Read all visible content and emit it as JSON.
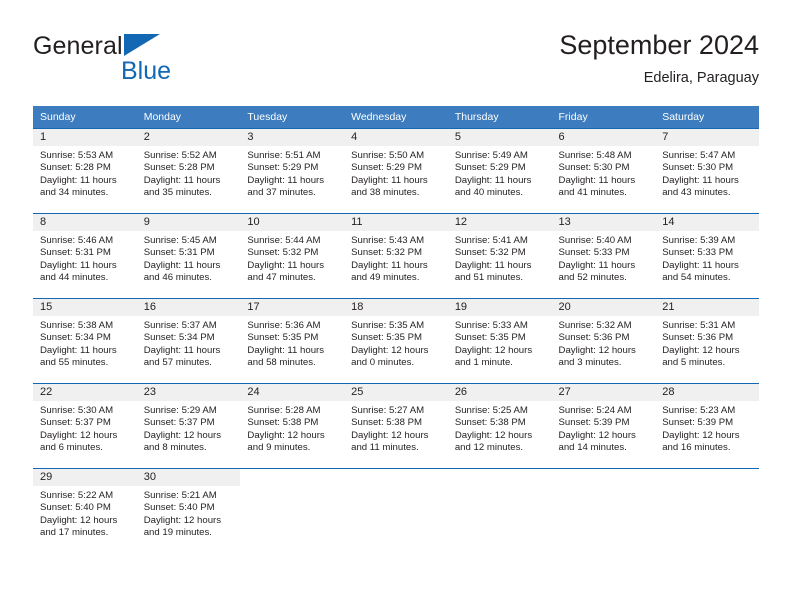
{
  "logo": {
    "word1": "General",
    "word2": "Blue",
    "triangle_color": "#1268b3"
  },
  "header": {
    "title": "September 2024",
    "subtitle": "Edelira, Paraguay"
  },
  "theme": {
    "header_bg": "#3c7cbf",
    "row_separator": "#1268b3",
    "daynum_bg": "#f0f0f0",
    "text": "#231f20"
  },
  "weekdays": [
    "Sunday",
    "Monday",
    "Tuesday",
    "Wednesday",
    "Thursday",
    "Friday",
    "Saturday"
  ],
  "labels": {
    "sunrise_prefix": "Sunrise:",
    "sunset_prefix": "Sunset:",
    "daylight_prefix": "Daylight:"
  },
  "weeks": [
    [
      {
        "day": "1",
        "sunrise": "Sunrise: 5:53 AM",
        "sunset": "Sunset: 5:28 PM",
        "daylight1": "Daylight: 11 hours",
        "daylight2": "and 34 minutes."
      },
      {
        "day": "2",
        "sunrise": "Sunrise: 5:52 AM",
        "sunset": "Sunset: 5:28 PM",
        "daylight1": "Daylight: 11 hours",
        "daylight2": "and 35 minutes."
      },
      {
        "day": "3",
        "sunrise": "Sunrise: 5:51 AM",
        "sunset": "Sunset: 5:29 PM",
        "daylight1": "Daylight: 11 hours",
        "daylight2": "and 37 minutes."
      },
      {
        "day": "4",
        "sunrise": "Sunrise: 5:50 AM",
        "sunset": "Sunset: 5:29 PM",
        "daylight1": "Daylight: 11 hours",
        "daylight2": "and 38 minutes."
      },
      {
        "day": "5",
        "sunrise": "Sunrise: 5:49 AM",
        "sunset": "Sunset: 5:29 PM",
        "daylight1": "Daylight: 11 hours",
        "daylight2": "and 40 minutes."
      },
      {
        "day": "6",
        "sunrise": "Sunrise: 5:48 AM",
        "sunset": "Sunset: 5:30 PM",
        "daylight1": "Daylight: 11 hours",
        "daylight2": "and 41 minutes."
      },
      {
        "day": "7",
        "sunrise": "Sunrise: 5:47 AM",
        "sunset": "Sunset: 5:30 PM",
        "daylight1": "Daylight: 11 hours",
        "daylight2": "and 43 minutes."
      }
    ],
    [
      {
        "day": "8",
        "sunrise": "Sunrise: 5:46 AM",
        "sunset": "Sunset: 5:31 PM",
        "daylight1": "Daylight: 11 hours",
        "daylight2": "and 44 minutes."
      },
      {
        "day": "9",
        "sunrise": "Sunrise: 5:45 AM",
        "sunset": "Sunset: 5:31 PM",
        "daylight1": "Daylight: 11 hours",
        "daylight2": "and 46 minutes."
      },
      {
        "day": "10",
        "sunrise": "Sunrise: 5:44 AM",
        "sunset": "Sunset: 5:32 PM",
        "daylight1": "Daylight: 11 hours",
        "daylight2": "and 47 minutes."
      },
      {
        "day": "11",
        "sunrise": "Sunrise: 5:43 AM",
        "sunset": "Sunset: 5:32 PM",
        "daylight1": "Daylight: 11 hours",
        "daylight2": "and 49 minutes."
      },
      {
        "day": "12",
        "sunrise": "Sunrise: 5:41 AM",
        "sunset": "Sunset: 5:32 PM",
        "daylight1": "Daylight: 11 hours",
        "daylight2": "and 51 minutes."
      },
      {
        "day": "13",
        "sunrise": "Sunrise: 5:40 AM",
        "sunset": "Sunset: 5:33 PM",
        "daylight1": "Daylight: 11 hours",
        "daylight2": "and 52 minutes."
      },
      {
        "day": "14",
        "sunrise": "Sunrise: 5:39 AM",
        "sunset": "Sunset: 5:33 PM",
        "daylight1": "Daylight: 11 hours",
        "daylight2": "and 54 minutes."
      }
    ],
    [
      {
        "day": "15",
        "sunrise": "Sunrise: 5:38 AM",
        "sunset": "Sunset: 5:34 PM",
        "daylight1": "Daylight: 11 hours",
        "daylight2": "and 55 minutes."
      },
      {
        "day": "16",
        "sunrise": "Sunrise: 5:37 AM",
        "sunset": "Sunset: 5:34 PM",
        "daylight1": "Daylight: 11 hours",
        "daylight2": "and 57 minutes."
      },
      {
        "day": "17",
        "sunrise": "Sunrise: 5:36 AM",
        "sunset": "Sunset: 5:35 PM",
        "daylight1": "Daylight: 11 hours",
        "daylight2": "and 58 minutes."
      },
      {
        "day": "18",
        "sunrise": "Sunrise: 5:35 AM",
        "sunset": "Sunset: 5:35 PM",
        "daylight1": "Daylight: 12 hours",
        "daylight2": "and 0 minutes."
      },
      {
        "day": "19",
        "sunrise": "Sunrise: 5:33 AM",
        "sunset": "Sunset: 5:35 PM",
        "daylight1": "Daylight: 12 hours",
        "daylight2": "and 1 minute."
      },
      {
        "day": "20",
        "sunrise": "Sunrise: 5:32 AM",
        "sunset": "Sunset: 5:36 PM",
        "daylight1": "Daylight: 12 hours",
        "daylight2": "and 3 minutes."
      },
      {
        "day": "21",
        "sunrise": "Sunrise: 5:31 AM",
        "sunset": "Sunset: 5:36 PM",
        "daylight1": "Daylight: 12 hours",
        "daylight2": "and 5 minutes."
      }
    ],
    [
      {
        "day": "22",
        "sunrise": "Sunrise: 5:30 AM",
        "sunset": "Sunset: 5:37 PM",
        "daylight1": "Daylight: 12 hours",
        "daylight2": "and 6 minutes."
      },
      {
        "day": "23",
        "sunrise": "Sunrise: 5:29 AM",
        "sunset": "Sunset: 5:37 PM",
        "daylight1": "Daylight: 12 hours",
        "daylight2": "and 8 minutes."
      },
      {
        "day": "24",
        "sunrise": "Sunrise: 5:28 AM",
        "sunset": "Sunset: 5:38 PM",
        "daylight1": "Daylight: 12 hours",
        "daylight2": "and 9 minutes."
      },
      {
        "day": "25",
        "sunrise": "Sunrise: 5:27 AM",
        "sunset": "Sunset: 5:38 PM",
        "daylight1": "Daylight: 12 hours",
        "daylight2": "and 11 minutes."
      },
      {
        "day": "26",
        "sunrise": "Sunrise: 5:25 AM",
        "sunset": "Sunset: 5:38 PM",
        "daylight1": "Daylight: 12 hours",
        "daylight2": "and 12 minutes."
      },
      {
        "day": "27",
        "sunrise": "Sunrise: 5:24 AM",
        "sunset": "Sunset: 5:39 PM",
        "daylight1": "Daylight: 12 hours",
        "daylight2": "and 14 minutes."
      },
      {
        "day": "28",
        "sunrise": "Sunrise: 5:23 AM",
        "sunset": "Sunset: 5:39 PM",
        "daylight1": "Daylight: 12 hours",
        "daylight2": "and 16 minutes."
      }
    ],
    [
      {
        "day": "29",
        "sunrise": "Sunrise: 5:22 AM",
        "sunset": "Sunset: 5:40 PM",
        "daylight1": "Daylight: 12 hours",
        "daylight2": "and 17 minutes."
      },
      {
        "day": "30",
        "sunrise": "Sunrise: 5:21 AM",
        "sunset": "Sunset: 5:40 PM",
        "daylight1": "Daylight: 12 hours",
        "daylight2": "and 19 minutes."
      },
      {
        "day": "",
        "sunrise": "",
        "sunset": "",
        "daylight1": "",
        "daylight2": "",
        "empty": true
      },
      {
        "day": "",
        "sunrise": "",
        "sunset": "",
        "daylight1": "",
        "daylight2": "",
        "empty": true
      },
      {
        "day": "",
        "sunrise": "",
        "sunset": "",
        "daylight1": "",
        "daylight2": "",
        "empty": true
      },
      {
        "day": "",
        "sunrise": "",
        "sunset": "",
        "daylight1": "",
        "daylight2": "",
        "empty": true
      },
      {
        "day": "",
        "sunrise": "",
        "sunset": "",
        "daylight1": "",
        "daylight2": "",
        "empty": true
      }
    ]
  ]
}
